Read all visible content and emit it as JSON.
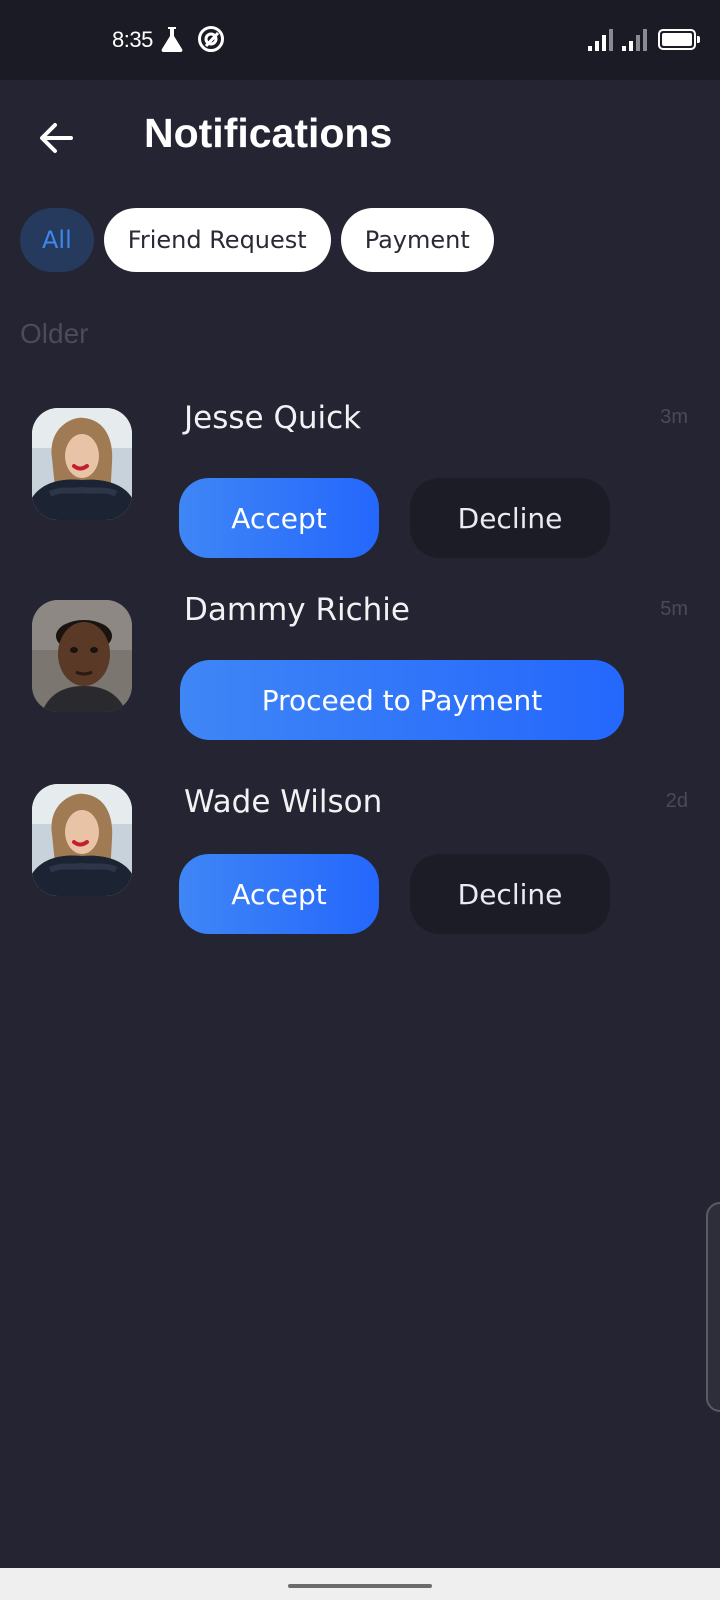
{
  "status_bar": {
    "time": "8:35",
    "icons": [
      "flask-icon",
      "at-sign-icon",
      "signal-icon",
      "signal-icon",
      "battery-icon"
    ]
  },
  "header": {
    "title": "Notifications"
  },
  "filters": {
    "all": "All",
    "friend_request": "Friend Request",
    "payment": "Payment"
  },
  "section": {
    "label": "Older"
  },
  "notifications": [
    {
      "name": "Jesse Quick",
      "time": "3m",
      "accept": "Accept",
      "decline": "Decline"
    },
    {
      "name": "Dammy Richie",
      "time": "5m",
      "proceed": "Proceed to Payment"
    },
    {
      "name": "Wade Wilson",
      "time": "2d",
      "accept": "Accept",
      "decline": "Decline"
    }
  ],
  "colors": {
    "background": "#242433",
    "status_bar": "#1b1b26",
    "accent": "#3a7ef7",
    "chip_active_bg": "#253a5c",
    "secondary_button": "#1c1c27"
  }
}
